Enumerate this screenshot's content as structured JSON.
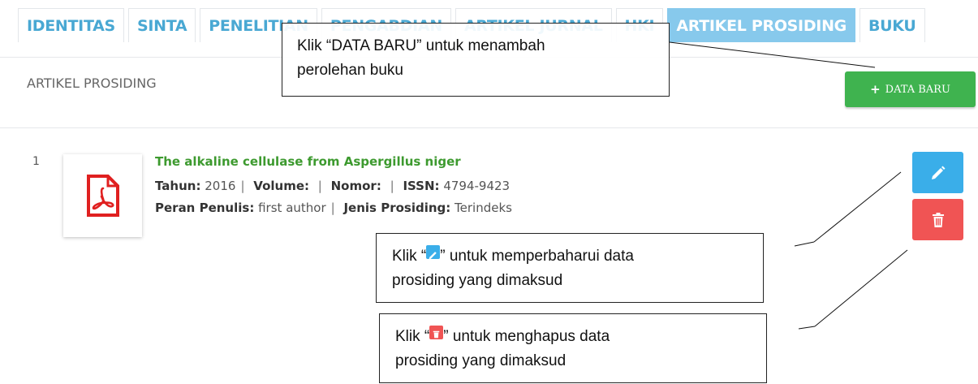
{
  "tabs": [
    {
      "label": "IDENTITAS",
      "active": false
    },
    {
      "label": "SINTA",
      "active": false
    },
    {
      "label": "PENELITIAN",
      "active": false
    },
    {
      "label": "PENGABDIAN",
      "active": false
    },
    {
      "label": "ARTIKEL JURNAL",
      "active": false
    },
    {
      "label": "HKI",
      "active": false
    },
    {
      "label": "ARTIKEL PROSIDING",
      "active": true
    },
    {
      "label": "BUKU",
      "active": false
    }
  ],
  "section": {
    "title": "ARTIKEL PROSIDING"
  },
  "toolbar": {
    "new_label": "DATA BARU",
    "new_icon": "plus-icon"
  },
  "item": {
    "number": "1",
    "icon": "pdf-file-icon",
    "title": "The alkaline cellulase from Aspergillus niger",
    "tahun_label": "Tahun:",
    "tahun": "2016",
    "volume_label": "Volume:",
    "volume": "",
    "nomor_label": "Nomor:",
    "nomor": "",
    "issn_label": "ISSN:",
    "issn": "4794-9423",
    "peran_label": "Peran Penulis:",
    "peran": "first author",
    "jenis_label": "Jenis Prosiding:",
    "jenis": "Terindeks",
    "edit_icon": "pencil-icon",
    "delete_icon": "trash-icon"
  },
  "callouts": {
    "new_line1": "Klik “DATA BARU” untuk menambah",
    "new_line2": "perolehan buku",
    "edit_pre": "Klik “",
    "edit_post": "” untuk memperbaharui data",
    "edit_line2": "prosiding yang dimaksud",
    "delete_pre": "Klik “",
    "delete_post": "” untuk menghapus data",
    "delete_line2": "prosiding yang dimaksud"
  },
  "colors": {
    "tab_text": "#49a8d3",
    "tab_active_bg": "#87c9ec",
    "new_button": "#3fb34f",
    "edit_button": "#3aaee9",
    "delete_button": "#f05454",
    "title_green": "#3d9a2f",
    "pdf_red": "#e02020"
  }
}
